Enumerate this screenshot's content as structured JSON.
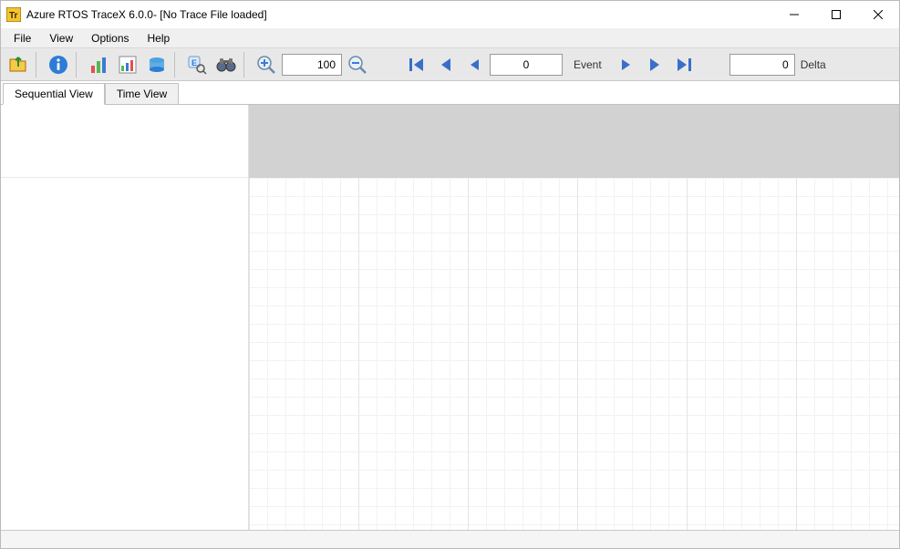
{
  "window": {
    "title": "Azure RTOS TraceX 6.0.0- [No Trace File loaded]"
  },
  "menu": {
    "file": "File",
    "view": "View",
    "options": "Options",
    "help": "Help"
  },
  "toolbar": {
    "zoom_value": "100",
    "event_value": "0",
    "event_label": "Event",
    "delta_value": "0",
    "delta_label": "Delta",
    "icons": {
      "open": "open-folder",
      "info": "info",
      "stats_bar": "bar-chart",
      "stats_sheet": "sheet-chart",
      "stack": "stack-db",
      "event_search": "event-magnifier",
      "binoculars": "binoculars",
      "zoom_in": "zoom-in",
      "zoom_out": "zoom-out",
      "nav_first": "first",
      "nav_prev_page": "prev-page",
      "nav_prev": "prev",
      "nav_next": "next",
      "nav_next_page": "next-page",
      "nav_last": "last"
    }
  },
  "tabs": {
    "sequential": "Sequential View",
    "time": "Time View"
  }
}
